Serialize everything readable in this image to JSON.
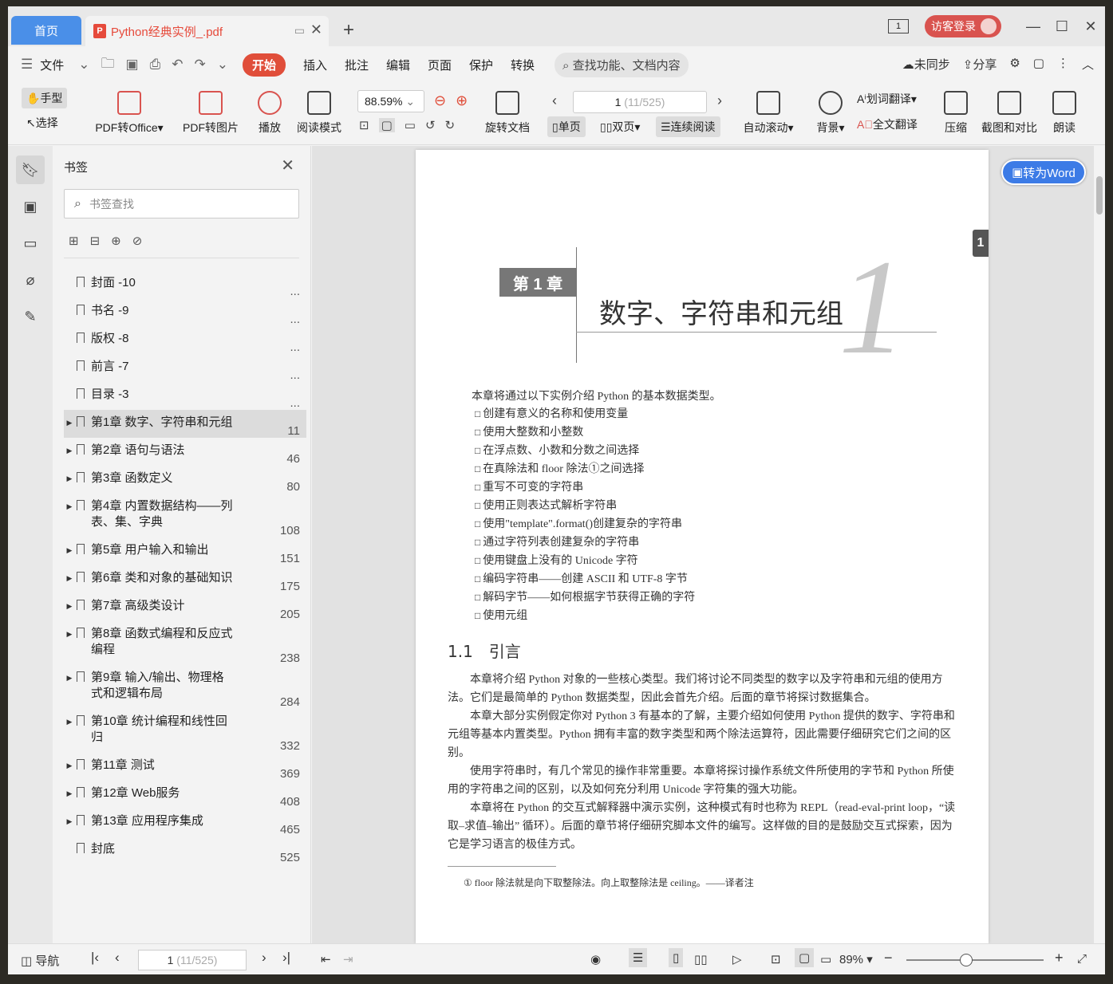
{
  "tabs": {
    "home": "首页",
    "doc_title": "Python经典实例_.pdf",
    "new_tab": "+"
  },
  "window": {
    "page_indicator": "1",
    "login": "访客登录"
  },
  "menu": {
    "file": "文件",
    "items": [
      "开始",
      "插入",
      "批注",
      "编辑",
      "页面",
      "保护",
      "转换"
    ],
    "search_placeholder": "查找功能、文档内容",
    "unsync": "未同步",
    "share": "分享"
  },
  "ribbon": {
    "hand": "手型",
    "select": "选择",
    "pdf_to_office": "PDF转Office",
    "pdf_to_image": "PDF转图片",
    "play": "播放",
    "read_mode": "阅读模式",
    "zoom": "88.59%",
    "rotate": "旋转文档",
    "page_current": "1",
    "page_total": "(11/525)",
    "single": "单页",
    "double": "双页",
    "continuous": "连续阅读",
    "autoscroll": "自动滚动",
    "background": "背景",
    "word_translate": "划词翻译",
    "full_translate": "全文翻译",
    "compress": "压缩",
    "screenshot": "截图和对比",
    "read_aloud": "朗读"
  },
  "bookmarks": {
    "title": "书签",
    "search_placeholder": "书签查找",
    "items": [
      {
        "label": "封面 -10",
        "page": "...",
        "expand": false
      },
      {
        "label": "书名 -9",
        "page": "...",
        "expand": false
      },
      {
        "label": "版权 -8",
        "page": "...",
        "expand": false
      },
      {
        "label": "前言 -7",
        "page": "...",
        "expand": false
      },
      {
        "label": "目录 -3",
        "page": "...",
        "expand": false
      },
      {
        "label": "第1章 数字、字符串和元组",
        "page": "11",
        "expand": true,
        "selected": true
      },
      {
        "label": "第2章 语句与语法",
        "page": "46",
        "expand": true
      },
      {
        "label": "第3章 函数定义",
        "page": "80",
        "expand": true
      },
      {
        "label": "第4章 内置数据结构——列表、集、字典",
        "page": "108",
        "expand": true
      },
      {
        "label": "第5章 用户输入和输出",
        "page": "151",
        "expand": true
      },
      {
        "label": "第6章 类和对象的基础知识",
        "page": "175",
        "expand": true
      },
      {
        "label": "第7章 高级类设计",
        "page": "205",
        "expand": true
      },
      {
        "label": "第8章 函数式编程和反应式编程",
        "page": "238",
        "expand": true
      },
      {
        "label": "第9章 输入/输出、物理格式和逻辑布局",
        "page": "284",
        "expand": true
      },
      {
        "label": "第10章 统计编程和线性回归",
        "page": "332",
        "expand": true
      },
      {
        "label": "第11章 测试",
        "page": "369",
        "expand": true
      },
      {
        "label": "第12章 Web服务",
        "page": "408",
        "expand": true
      },
      {
        "label": "第13章 应用程序集成",
        "page": "465",
        "expand": true
      },
      {
        "label": "封底",
        "page": "525",
        "expand": false
      }
    ]
  },
  "page": {
    "chapter_label": "第 1 章",
    "chapter_title": "数字、字符串和元组",
    "big_number": "1",
    "side_number": "1",
    "intro": "本章将通过以下实例介绍 Python 的基本数据类型。",
    "list": [
      "创建有意义的名称和使用变量",
      "使用大整数和小整数",
      "在浮点数、小数和分数之间选择",
      "在真除法和 floor 除法①之间选择",
      "重写不可变的字符串",
      "使用正则表达式解析字符串",
      "使用\"template\".format()创建复杂的字符串",
      "通过字符列表创建复杂的字符串",
      "使用键盘上没有的 Unicode 字符",
      "编码字符串——创建 ASCII 和 UTF-8 字节",
      "解码字节——如何根据字节获得正确的字符",
      "使用元组"
    ],
    "section": "1.1　引言",
    "paragraphs": [
      "本章将介绍 Python 对象的一些核心类型。我们将讨论不同类型的数字以及字符串和元组的使用方法。它们是最简单的 Python 数据类型，因此会首先介绍。后面的章节将探讨数据集合。",
      "本章大部分实例假定你对 Python 3 有基本的了解，主要介绍如何使用 Python 提供的数字、字符串和元组等基本内置类型。Python 拥有丰富的数字类型和两个除法运算符，因此需要仔细研究它们之间的区别。",
      "使用字符串时，有几个常见的操作非常重要。本章将探讨操作系统文件所使用的字节和 Python 所使用的字符串之间的区别，以及如何充分利用 Unicode 字符集的强大功能。",
      "本章将在 Python 的交互式解释器中演示实例，这种模式有时也称为 REPL（read-eval-print loop，“读取–求值–输出” 循环）。后面的章节将仔细研究脚本文件的编写。这样做的目的是鼓励交互式探索，因为它是学习语言的极佳方式。"
    ],
    "footnote": "① floor 除法就是向下取整除法。向上取整除法是 ceiling。——译者注"
  },
  "to_word": "转为Word",
  "status": {
    "nav": "导航",
    "page_current": "1",
    "page_total": "(11/525)",
    "zoom": "89%"
  }
}
